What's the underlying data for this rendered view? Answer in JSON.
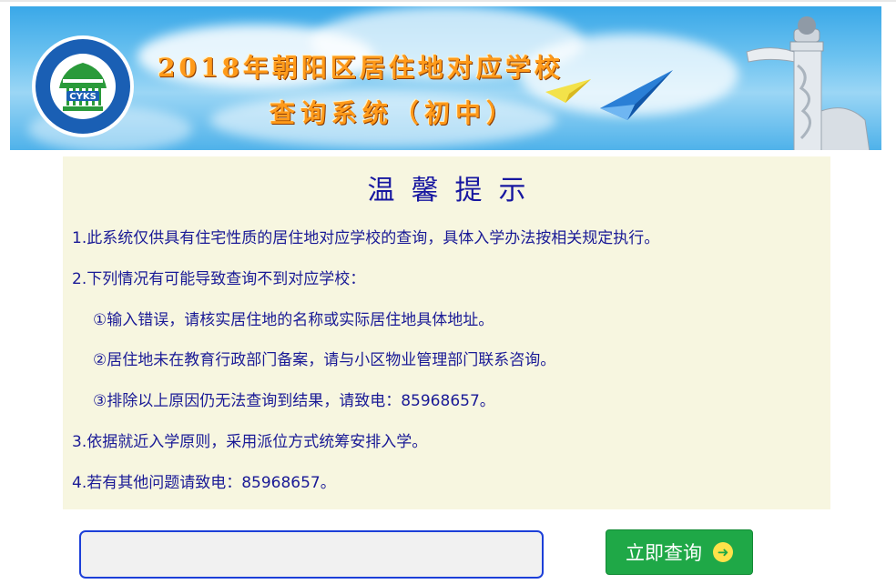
{
  "banner": {
    "title_line1": "2018年朝阳区居住地对应学校",
    "title_line2": "查询系统（初中）",
    "logo_text": "CYKS",
    "logo_ring_text": "北京市朝阳区招生考试中心",
    "colors": {
      "title": "#ff9a1a",
      "sky": "#4fb2ea",
      "logo_green": "#2a9a3a",
      "logo_blue": "#1a5fb4"
    }
  },
  "notice": {
    "title": "温馨提示",
    "lines": [
      "1.此系统仅供具有住宅性质的居住地对应学校的查询，具体入学办法按相关规定执行。",
      "2.下列情况有可能导致查询不到对应学校：",
      "①输入错误，请核实居住地的名称或实际居住地具体地址。",
      "②居住地未在教育行政部门备案，请与小区物业管理部门联系咨询。",
      "③排除以上原因仍无法查询到结果，请致电：85968657。",
      "3.依据就近入学原则，采用派位方式统筹安排入学。",
      "4.若有其他问题请致电：85968657。"
    ],
    "colors": {
      "background": "#f7f6e0",
      "text": "#1a1a96"
    }
  },
  "search": {
    "input_value": "",
    "button_label": "立即查询",
    "button_icon": "arrow-circle-right-icon",
    "colors": {
      "button": "#1fa847",
      "input_border": "#1c3fd8"
    }
  }
}
